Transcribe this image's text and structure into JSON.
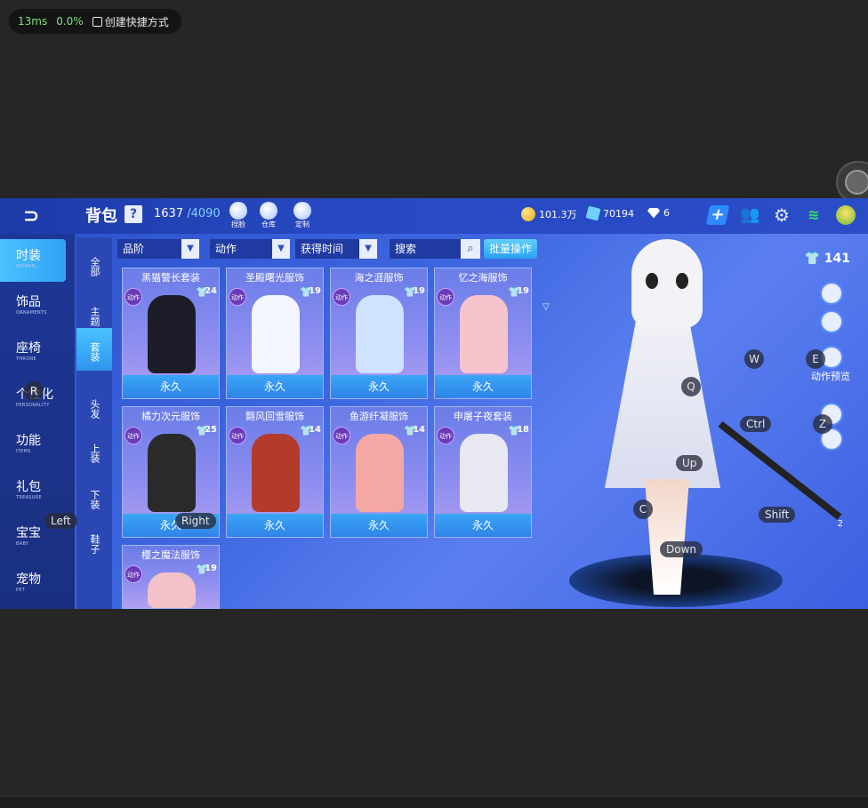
{
  "stats": {
    "latency": "13ms",
    "loss": "0.0%",
    "shortcut_label": "创建快捷方式"
  },
  "header": {
    "title": "背包",
    "help": "?",
    "capacity_used": "1637",
    "capacity_max": "/4090",
    "buttons": [
      {
        "label": "捏脸"
      },
      {
        "label": "仓库"
      },
      {
        "label": "定制"
      }
    ],
    "currencies": [
      {
        "value": "101.3万"
      },
      {
        "value": "70194"
      },
      {
        "value": "6"
      }
    ]
  },
  "left_nav": [
    {
      "zh": "时装",
      "en": "APPAREL",
      "active": true
    },
    {
      "zh": "饰品",
      "en": "ORNAMENTS"
    },
    {
      "zh": "座椅",
      "en": "THRONE"
    },
    {
      "zh": "个性化",
      "en": "PERSONALITY"
    },
    {
      "zh": "功能",
      "en": "ITEMS"
    },
    {
      "zh": "礼包",
      "en": "TREASURE"
    },
    {
      "zh": "宝宝",
      "en": "BABY"
    },
    {
      "zh": "宠物",
      "en": "PET"
    }
  ],
  "sub_nav": [
    {
      "label": "全部"
    },
    {
      "label": "主题"
    },
    {
      "label": "套装",
      "active": true
    },
    {
      "label": "头发"
    },
    {
      "label": "上装"
    },
    {
      "label": "下装"
    },
    {
      "label": "鞋子"
    }
  ],
  "filters": {
    "grade": "品阶",
    "action": "动作",
    "acquire_time": "获得时间",
    "search": "搜索",
    "batch": "批量操作"
  },
  "items": [
    {
      "name": "黑猫警长套装",
      "level": "24",
      "tag": "动作",
      "status": "永久",
      "color": "#1d1d2a"
    },
    {
      "name": "圣殿曙光服饰",
      "level": "19",
      "tag": "动作",
      "status": "永久",
      "color": "#f4f6ff"
    },
    {
      "name": "海之涯服饰",
      "level": "19",
      "tag": "动作",
      "status": "永久",
      "color": "#cfe2ff"
    },
    {
      "name": "忆之海服饰",
      "level": "19",
      "tag": "动作",
      "status": "永久",
      "color": "#f6c4cc"
    },
    {
      "name": "橘力次元服饰",
      "level": "25",
      "tag": "动作",
      "status": "永久",
      "color": "#2a2a2a"
    },
    {
      "name": "翾风回雪服饰",
      "level": "14",
      "tag": "动作",
      "status": "永久",
      "color": "#b43a2a"
    },
    {
      "name": "鱼游纤凝服饰",
      "level": "14",
      "tag": "动作",
      "status": "永久",
      "color": "#f5a8a3"
    },
    {
      "name": "申屠子夜套装",
      "level": "18",
      "tag": "动作",
      "status": "永久",
      "color": "#e8e8f0"
    },
    {
      "name": "樱之魔法服饰",
      "level": "19",
      "tag": "动作",
      "status": "",
      "color": "#f2c2c8"
    }
  ],
  "right_panel": {
    "count": "141",
    "preview_label": "动作预览",
    "count2": "2"
  },
  "keys": [
    "W",
    "E",
    "Q",
    "Ctrl",
    "Z",
    "Up",
    "C",
    "Shift",
    "Down",
    "R",
    "Left",
    "Right"
  ]
}
